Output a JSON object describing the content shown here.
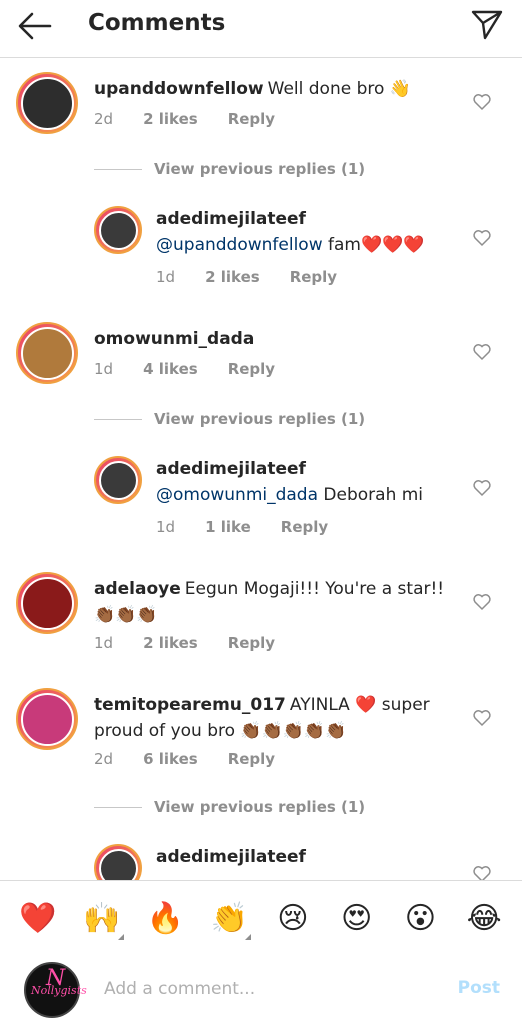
{
  "header": {
    "title": "Comments",
    "back_icon": "arrow-left-icon",
    "send_icon": "paper-plane-icon"
  },
  "comments": [
    {
      "user": "upanddownfellow",
      "text": "Well done bro 👋",
      "age": "2d",
      "likes": "2 likes",
      "reply": "Reply",
      "avatar_color": "#2d2d2d"
    },
    {
      "user": "adedimejilateef",
      "mention": "@upanddownfellow",
      "text": "fam❤️❤️❤️",
      "age": "1d",
      "likes": "2 likes",
      "reply": "Reply",
      "avatar_color": "#3a3a3a"
    },
    {
      "user": "omowunmi_dada",
      "text": "",
      "age": "1d",
      "likes": "4 likes",
      "reply": "Reply",
      "avatar_color": "#b07a3c"
    },
    {
      "user": "adedimejilateef",
      "mention": "@omowunmi_dada",
      "text": "Deborah mi",
      "age": "1d",
      "likes": "1 like",
      "reply": "Reply",
      "avatar_color": "#3a3a3a"
    },
    {
      "user": "adelaoye",
      "text": "Eegun Mogaji!!! You're a star!!",
      "text2": "👏🏾👏🏾👏🏾",
      "age": "1d",
      "likes": "2 likes",
      "reply": "Reply",
      "avatar_color": "#8a1a1a"
    },
    {
      "user": "temitopearemu_017",
      "text": "AYINLA ❤️ super",
      "text2": "proud of you bro 👏🏾👏🏾👏🏾👏🏾👏🏾",
      "age": "2d",
      "likes": "6 likes",
      "reply": "Reply",
      "avatar_color": "#c83a7a"
    },
    {
      "user": "adedimejilateef",
      "mention": "",
      "text": "",
      "avatar_color": "#3a3a3a"
    }
  ],
  "view_previous": "View previous replies (1)",
  "emoji_bar": [
    "❤️",
    "🙌",
    "🔥",
    "👏",
    "😢",
    "😍",
    "😮",
    "😂"
  ],
  "compose": {
    "placeholder": "Add a comment...",
    "post_label": "Post",
    "avatar_text": "Nollygists"
  },
  "colors": {
    "accent": "#b2dffc",
    "mention": "#003569",
    "meta": "#8e8e8e"
  }
}
